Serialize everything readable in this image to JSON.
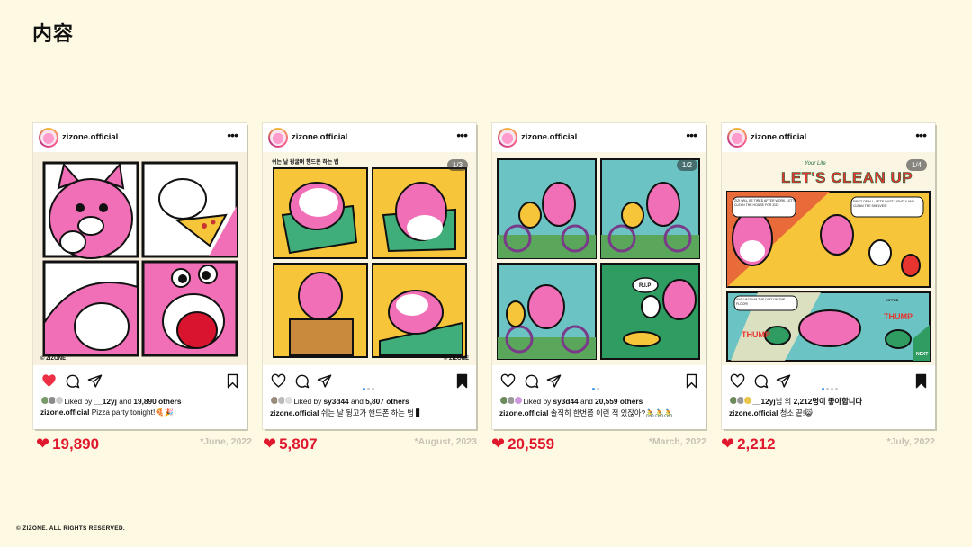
{
  "page": {
    "title": "内容",
    "footer": "© ZIZONE. ALL RIGHTS RESERVED."
  },
  "posts": [
    {
      "username": "zizone.official",
      "counter": "",
      "liked_prefix": "Liked by ",
      "liked_user": "__12yj",
      "liked_mid": " and ",
      "liked_count": "19,890 others",
      "caption_user": "zizone.official",
      "caption_text": " Pizza party tonight!🍕🎉",
      "heart_liked": true,
      "likes": "19,890",
      "date": "*June, 2022",
      "watermark": "© ZIZONE"
    },
    {
      "username": "zizone.official",
      "counter": "1/3",
      "image_title": "쉬는 날 뒹굴며 핸드폰 하는 법",
      "liked_prefix": "Liked by ",
      "liked_user": "sy3d44",
      "liked_mid": " and ",
      "liked_count": "5,807 others",
      "caption_user": "zizone.official",
      "caption_text": " 쉬는 날 뒹고가 핸드폰 하는 법 ▋_",
      "heart_liked": false,
      "likes": "5,807",
      "date": "*August, 2023",
      "watermark": "© ZIZONE"
    },
    {
      "username": "zizone.official",
      "counter": "1/2",
      "image_label": "R.I.P",
      "liked_prefix": "Liked by ",
      "liked_user": "sy3d44",
      "liked_mid": " and ",
      "liked_count": "20,559 others",
      "caption_user": "zizone.official",
      "caption_text": " 솔직히 한번쯤 이런 적 있잖아?🚴🚴🚴",
      "heart_liked": false,
      "likes": "20,559",
      "date": "*March, 2022"
    },
    {
      "username": "zizone.official",
      "counter": "1/4",
      "image_title": "LET'S CLEAN UP",
      "image_small": "Your Life",
      "image_bubble1": "ZIZI WILL BE TIRED AFTER WORK. LET'S CLEAN THE HOUSE FOR ZIZI!",
      "image_bubble2": "FIRST OF ALL, LET'S DUST LIGHTLY AND CLEAN THE SHELVES!",
      "image_bubble3": "AND VACUUM THE DIRT ON THE FLOOR!",
      "image_sfx1": "THUMP",
      "image_sfx2": "THUMP",
      "image_sfx3": "YIPPEE",
      "image_next": "NEXT",
      "liked_prefix": "",
      "liked_user": "__12yj",
      "liked_mid": "님 외 ",
      "liked_count": "2,212명이 좋아합니다",
      "caption_user": "zizone.official",
      "caption_text": " 청소 끝!😸",
      "heart_liked": false,
      "likes": "2,212",
      "date": "*July, 2022"
    }
  ],
  "colors": {
    "background": "#fdf9e3",
    "accent_red": "#e0182d",
    "comic_pink": "#f06fb6",
    "comic_yellow": "#f7c53a",
    "comic_teal": "#6cc3c3",
    "comic_green": "#2f9c62"
  },
  "icons": [
    "heart-icon",
    "comment-icon",
    "share-icon",
    "bookmark-icon",
    "more-icon"
  ]
}
